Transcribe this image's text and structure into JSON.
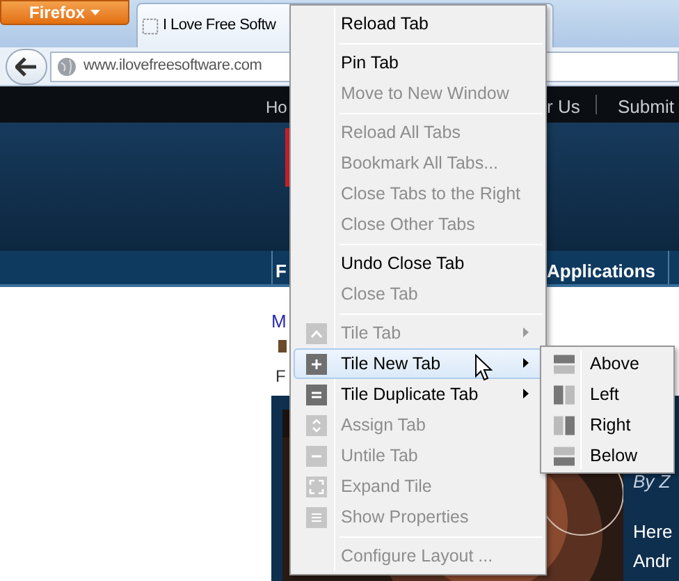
{
  "browser": {
    "app_button": "Firefox",
    "tab_title": "I Love Free Softw",
    "url": "www.ilovefreesoftware.com"
  },
  "page": {
    "top_links": [
      "Ho",
      "r Us",
      "Submit"
    ],
    "nav_links": [
      "F",
      "Applications"
    ],
    "link": "M",
    "caption": "F",
    "byline": "By Z",
    "text_lines": [
      "Here",
      "Andr"
    ]
  },
  "context_menu": {
    "sections": [
      {
        "items": [
          {
            "label": "Reload Tab",
            "disabled": false,
            "highlighted": false
          }
        ]
      },
      {
        "items": [
          {
            "label": "Pin Tab",
            "disabled": false,
            "highlighted": false
          },
          {
            "label": "Move to New Window",
            "disabled": true,
            "highlighted": false
          }
        ]
      },
      {
        "items": [
          {
            "label": "Reload All Tabs",
            "disabled": true,
            "highlighted": false
          },
          {
            "label": "Bookmark All Tabs...",
            "disabled": true,
            "highlighted": false
          },
          {
            "label": "Close Tabs to the Right",
            "disabled": true,
            "highlighted": false
          },
          {
            "label": "Close Other Tabs",
            "disabled": true,
            "highlighted": false
          }
        ]
      },
      {
        "items": [
          {
            "label": "Undo Close Tab",
            "disabled": false,
            "highlighted": false
          },
          {
            "label": "Close Tab",
            "disabled": true,
            "highlighted": false
          }
        ]
      },
      {
        "items": [
          {
            "label": "Tile Tab",
            "disabled": true,
            "highlighted": false,
            "has_submenu": true
          },
          {
            "label": "Tile New Tab",
            "disabled": false,
            "highlighted": true,
            "has_submenu": true
          },
          {
            "label": "Tile Duplicate Tab",
            "disabled": false,
            "highlighted": false,
            "has_submenu": true
          },
          {
            "label": "Assign Tab",
            "disabled": true,
            "highlighted": false,
            "has_submenu": false
          },
          {
            "label": "Untile Tab",
            "disabled": true,
            "highlighted": false,
            "has_submenu": false
          },
          {
            "label": "Expand Tile",
            "disabled": true,
            "highlighted": false,
            "has_submenu": false
          },
          {
            "label": "Show Properties",
            "disabled": true,
            "highlighted": false,
            "has_submenu": false
          }
        ]
      },
      {
        "items": [
          {
            "label": "Configure Layout ...",
            "disabled": true,
            "highlighted": false
          }
        ]
      }
    ]
  },
  "submenu": {
    "items": [
      {
        "label": "Above"
      },
      {
        "label": "Left"
      },
      {
        "label": "Right"
      },
      {
        "label": "Below"
      }
    ]
  }
}
